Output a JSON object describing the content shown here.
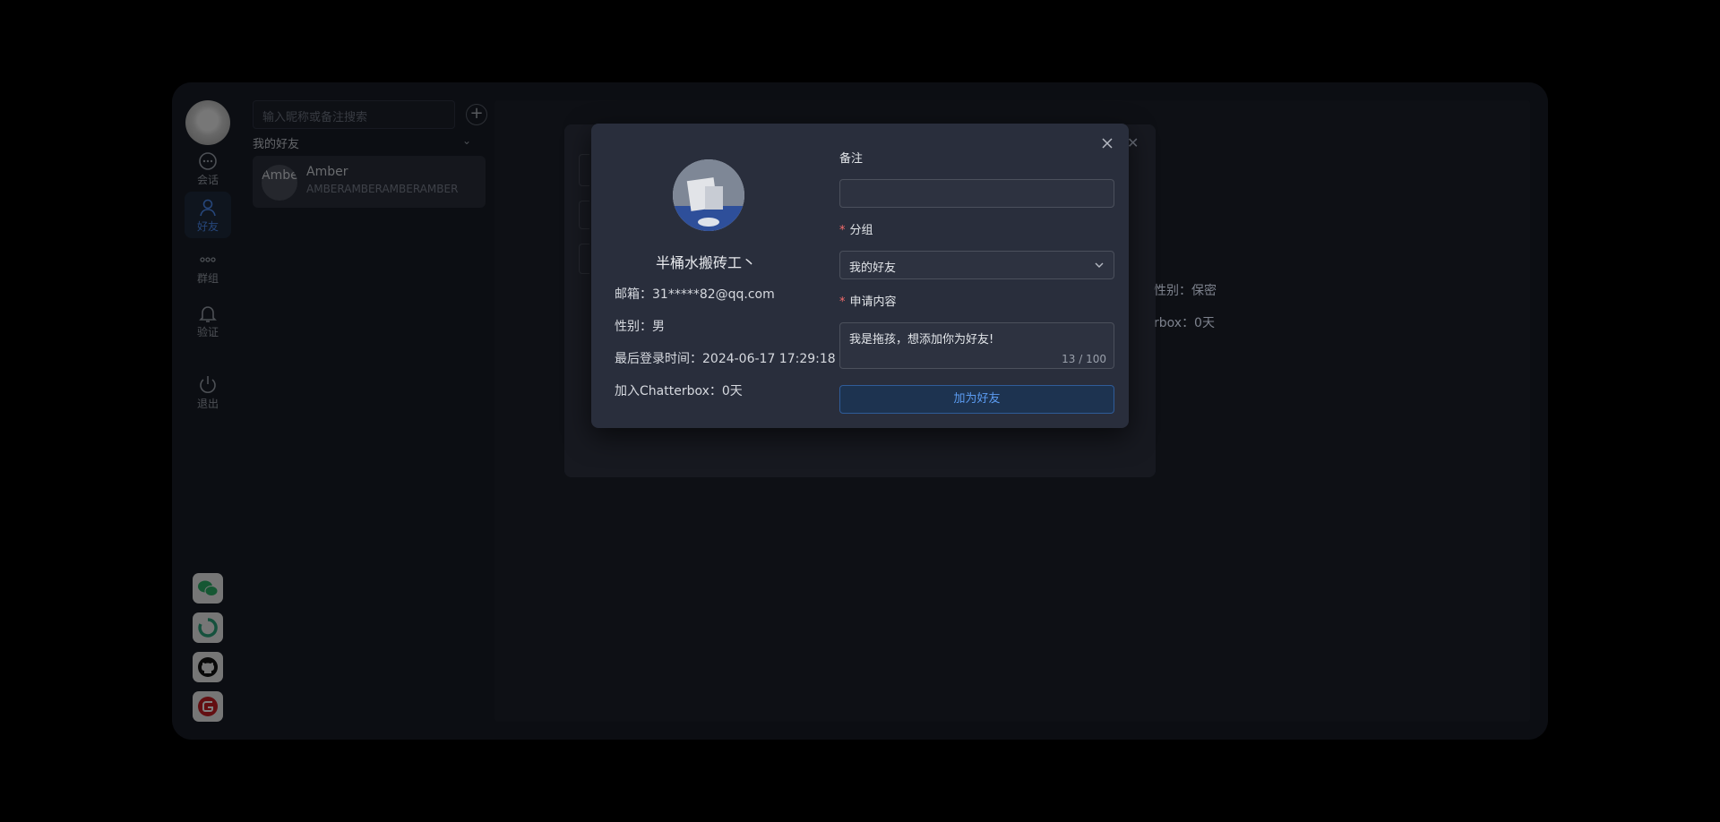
{
  "sidebar": {
    "nav": [
      {
        "label": "会话",
        "icon": "chat-icon"
      },
      {
        "label": "好友",
        "icon": "user-icon"
      },
      {
        "label": "群组",
        "icon": "group-dots-icon"
      },
      {
        "label": "验证",
        "icon": "bell-icon"
      },
      {
        "label": "退出",
        "icon": "power-icon"
      }
    ],
    "social": [
      "wechat-icon",
      "loop-icon",
      "github-icon",
      "gitee-icon"
    ]
  },
  "friends": {
    "search_placeholder": "输入昵称或备注搜索",
    "group_title": "我的好友",
    "items": [
      {
        "avatar_text": "Amber",
        "name": "Amber",
        "sub": "AMBERAMBERAMBERAMBER"
      }
    ]
  },
  "background_dialog": {
    "gender_partial": "性别：保密",
    "join_partial": "rbox：0天"
  },
  "dialog": {
    "nickname": "半桶水搬砖工丶",
    "email": "邮箱：31*****82@qq.com",
    "gender": "性别：男",
    "last_login": "最后登录时间：2024-06-17 17:29:18",
    "join": "加入Chatterbox：0天",
    "remark_label": "备注",
    "remark_value": "",
    "group_label": "分组",
    "group_value": "我的好友",
    "message_label": "申请内容",
    "message_value": "我是拖孩，想添加你为好友!",
    "message_count": "13 / 100",
    "submit_label": "加为好友"
  },
  "colors": {
    "accent": "#4d8cf5",
    "required": "#f56c6c",
    "dialog_bg": "#292e3c"
  }
}
